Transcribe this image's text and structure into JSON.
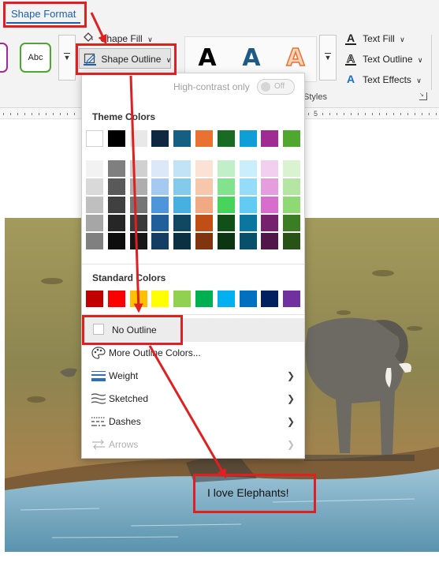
{
  "ribbon": {
    "tab_label": "Shape Format",
    "shape_fill_label": "Shape Fill",
    "shape_outline_label": "Shape Outline",
    "shape_style_sample": "Abc",
    "wordart_letters": [
      "A",
      "A",
      "A"
    ],
    "text_fill_label": "Text Fill",
    "text_outline_label": "Text Outline",
    "text_effects_label": "Text Effects",
    "styles_group_label": "Styles"
  },
  "ruler": {
    "marker": "5"
  },
  "outline_menu": {
    "high_contrast_label": "High-contrast only",
    "high_contrast_state": "Off",
    "theme_colors_label": "Theme Colors",
    "theme_top_row": [
      "#ffffff",
      "#000000",
      "#e8e8e8",
      "#0e2841",
      "#156082",
      "#e97132",
      "#196b24",
      "#0f9ed5",
      "#a02b93",
      "#4ea72e"
    ],
    "theme_shades": [
      [
        "#f2f2f2",
        "#7f7f7f",
        "#d0d0d0",
        "#dae8f8",
        "#c0e4f5",
        "#fbe2d5",
        "#c1f0c8",
        "#caeefb",
        "#f2cfee",
        "#d9f2d0"
      ],
      [
        "#d9d9d9",
        "#595959",
        "#aeaeae",
        "#a5c9ef",
        "#83caeb",
        "#f7c7ac",
        "#83e28e",
        "#94dcf8",
        "#e59edd",
        "#b4e5a2"
      ],
      [
        "#bfbfbf",
        "#404040",
        "#757575",
        "#4e95d9",
        "#45b0e1",
        "#f1a983",
        "#47d45a",
        "#61cbf3",
        "#d86dcd",
        "#8ed973"
      ],
      [
        "#a6a6a6",
        "#262626",
        "#3a3a3a",
        "#215f9a",
        "#104862",
        "#c04f15",
        "#12501a",
        "#0b769f",
        "#77206d",
        "#3a7d22"
      ],
      [
        "#808080",
        "#0d0d0d",
        "#171717",
        "#153d64",
        "#0a3041",
        "#80350e",
        "#0c3511",
        "#074f6a",
        "#501549",
        "#275317"
      ]
    ],
    "standard_colors_label": "Standard Colors",
    "standard_colors": [
      "#c00000",
      "#ff0000",
      "#ffc000",
      "#ffff00",
      "#92d050",
      "#00b050",
      "#00b0f0",
      "#0070c0",
      "#002060",
      "#7030a0"
    ],
    "no_outline_label": "No Outline",
    "more_colors_label": "More Outline Colors...",
    "weight_label": "Weight",
    "sketched_label": "Sketched",
    "dashes_label": "Dashes",
    "arrows_label": "Arrows"
  },
  "document": {
    "caption": "I love Elephants!"
  },
  "colors": {
    "annotation_red": "#e02020",
    "accent_blue": "#1a5fb4"
  }
}
